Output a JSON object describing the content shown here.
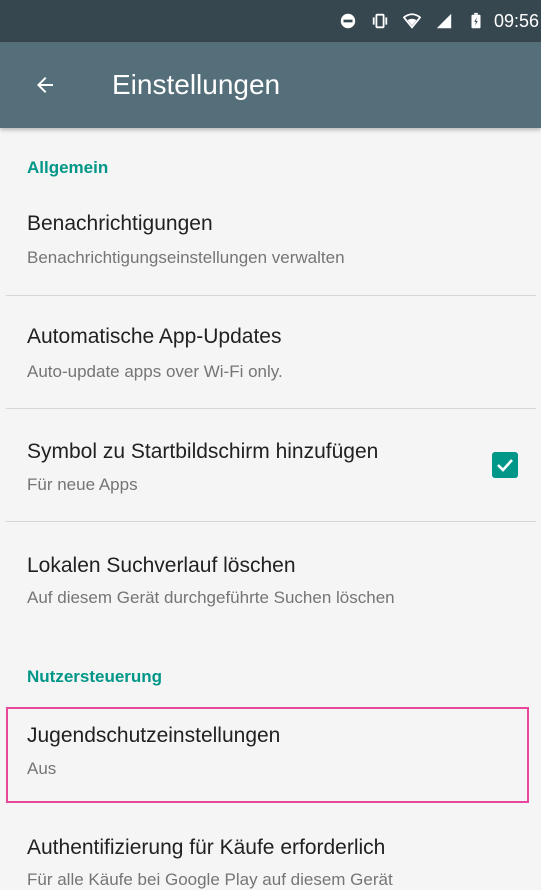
{
  "status_bar": {
    "time": "09:56",
    "icons": [
      "do-not-disturb-icon",
      "vibrate-icon",
      "wifi-icon",
      "signal-icon",
      "battery-icon"
    ]
  },
  "app_bar": {
    "title": "Einstellungen",
    "back_icon": "arrow-back-icon"
  },
  "sections": {
    "general": {
      "header": "Allgemein"
    },
    "user_control": {
      "header": "Nutzersteuerung"
    }
  },
  "items": {
    "notifications": {
      "title": "Benachrichtigungen",
      "subtitle": "Benachrichtigungseinstellungen verwalten"
    },
    "auto_update": {
      "title": "Automatische App-Updates",
      "subtitle": "Auto-update apps over Wi-Fi only."
    },
    "home_icon": {
      "title": "Symbol zu Startbildschirm hinzufügen",
      "subtitle": "Für neue Apps",
      "checked": true
    },
    "clear_history": {
      "title": "Lokalen Suchverlauf löschen",
      "subtitle": "Auf diesem Gerät durchgeführte Suchen löschen"
    },
    "parental": {
      "title": "Jugendschutzeinstellungen",
      "subtitle": "Aus"
    },
    "auth": {
      "title": "Authentifizierung für Käufe erforderlich",
      "subtitle": "Für alle Käufe bei Google Play auf diesem Gerät"
    }
  },
  "colors": {
    "accent": "#009688",
    "app_bar": "#546e7a",
    "status_bar": "#37474f",
    "highlight": "#e9479b"
  }
}
